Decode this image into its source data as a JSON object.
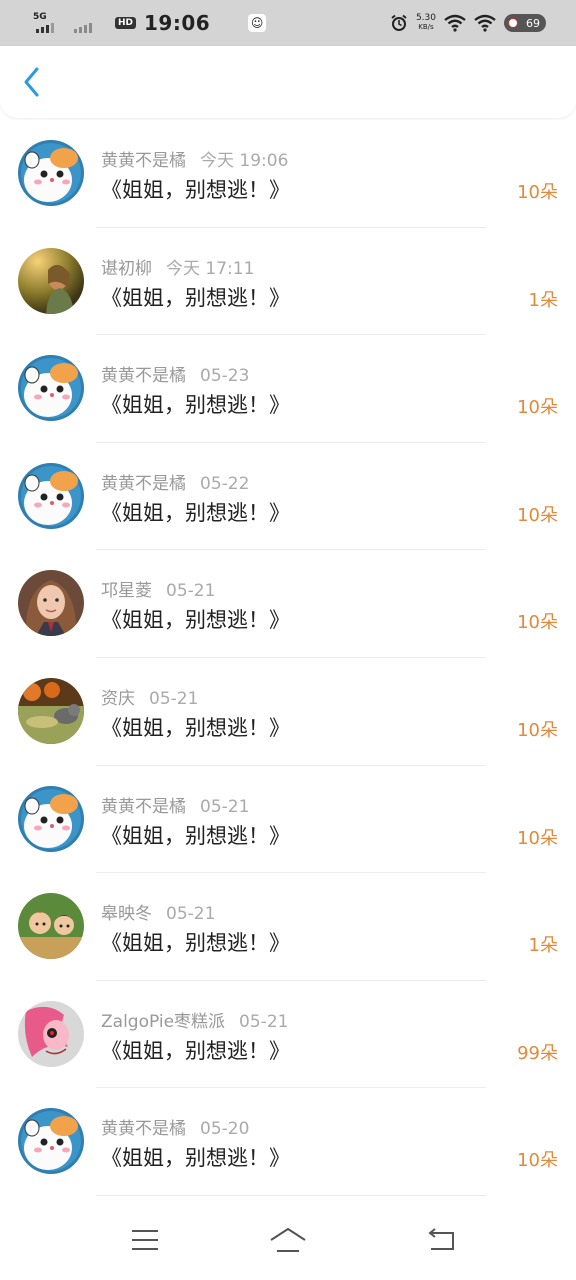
{
  "status_bar": {
    "network_label": "5G",
    "hd_label": "HD",
    "time": "19:06",
    "speed_value": "5.30",
    "speed_unit": "KB/s",
    "battery": "69"
  },
  "header": {
    "back_icon": "chevron-left-icon",
    "accent_color": "#2a9ae0"
  },
  "list": {
    "count_color": "#e08a3a",
    "items": [
      {
        "name": "黄黄不是橘",
        "time": "今天 19:06",
        "title": "《姐姐，别想逃！》",
        "count": "10朵",
        "avatar": "hamster"
      },
      {
        "name": "谌初柳",
        "time": "今天 17:11",
        "title": "《姐姐，别想逃！》",
        "count": "1朵",
        "avatar": "girl-field"
      },
      {
        "name": "黄黄不是橘",
        "time": "05-23",
        "title": "《姐姐，别想逃！》",
        "count": "10朵",
        "avatar": "hamster"
      },
      {
        "name": "黄黄不是橘",
        "time": "05-22",
        "title": "《姐姐，别想逃！》",
        "count": "10朵",
        "avatar": "hamster"
      },
      {
        "name": "邛星菱",
        "time": "05-21",
        "title": "《姐姐，别想逃！》",
        "count": "10朵",
        "avatar": "portrait-girl"
      },
      {
        "name": "资庆",
        "time": "05-21",
        "title": "《姐姐，别想逃！》",
        "count": "10朵",
        "avatar": "cat-pumpkin"
      },
      {
        "name": "黄黄不是橘",
        "time": "05-21",
        "title": "《姐姐，别想逃！》",
        "count": "10朵",
        "avatar": "hamster"
      },
      {
        "name": "皋映冬",
        "time": "05-21",
        "title": "《姐姐，别想逃！》",
        "count": "1朵",
        "avatar": "cartoon-kids"
      },
      {
        "name": "ZalgoPie枣糕派",
        "time": "05-21",
        "title": "《姐姐，别想逃！》",
        "count": "99朵",
        "avatar": "pink-pony"
      },
      {
        "name": "黄黄不是橘",
        "time": "05-20",
        "title": "《姐姐，别想逃！》",
        "count": "10朵",
        "avatar": "hamster"
      }
    ]
  },
  "nav_bar": {
    "menu_icon": "menu-icon",
    "home_icon": "home-icon",
    "back_icon": "back-icon"
  }
}
